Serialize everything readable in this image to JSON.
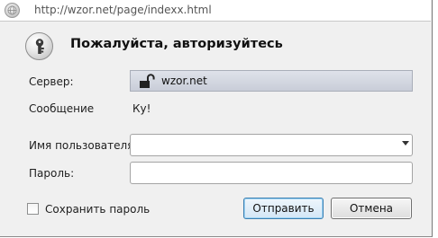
{
  "urlbar": {
    "url": "http://wzor.net/page/indexx.html",
    "icon": "globe-icon"
  },
  "dialog": {
    "icon": "keyhole-lock-icon",
    "title": "Пожалуйста, авторизуйтесь",
    "server_label": "Сервер:",
    "server_value": "wzor.net",
    "server_icon": "open-padlock-icon",
    "message_label": "Сообщение",
    "message_value": "Ку!",
    "username_label": "Имя пользователя:",
    "username_value": "",
    "password_label": "Пароль:",
    "password_value": "",
    "remember_label": "Сохранить пароль",
    "remember_checked": false,
    "submit_label": "Отправить",
    "cancel_label": "Отмена"
  },
  "colors": {
    "primary_button_border": "#3c7fb1",
    "server_box_background": "#d4d8e2",
    "dialog_background": "#f0f0f0"
  }
}
